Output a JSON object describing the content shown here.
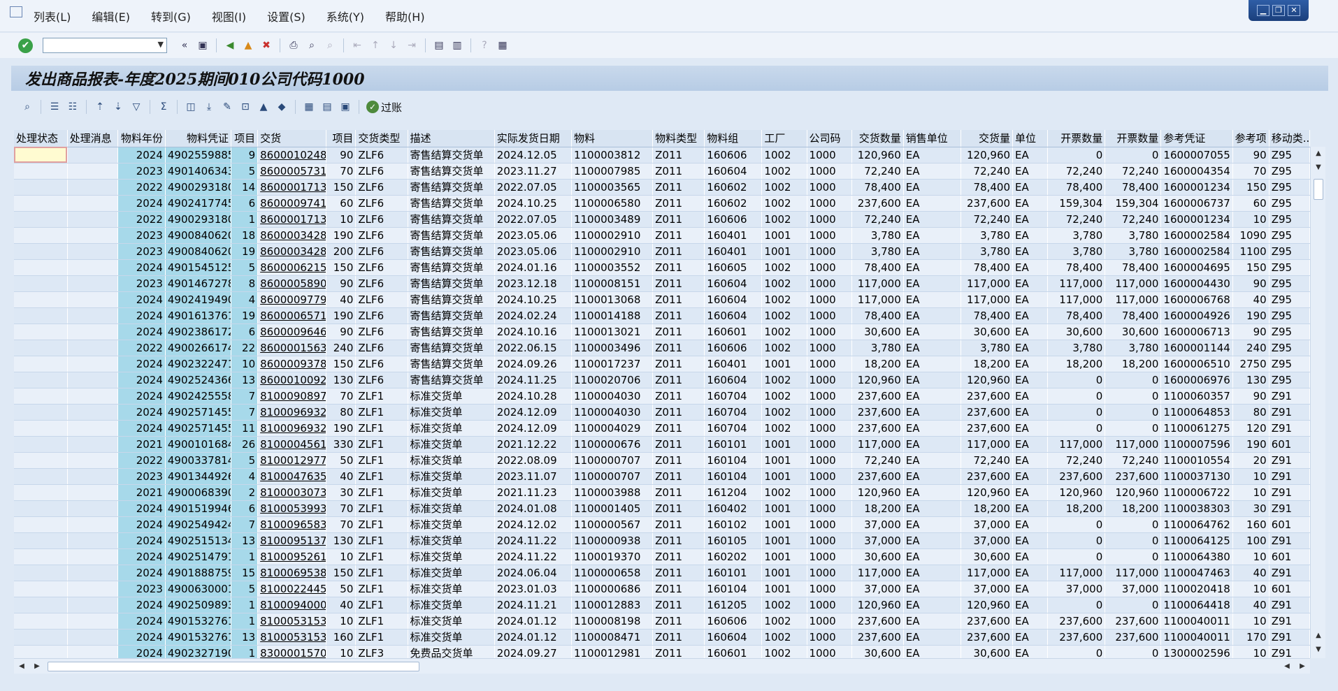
{
  "menubar": {
    "items": [
      "列表(L)",
      "编辑(E)",
      "转到(G)",
      "视图(I)",
      "设置(S)",
      "系统(Y)",
      "帮助(H)"
    ]
  },
  "toolbar": {
    "command_value": "",
    "back_glyph": "«"
  },
  "header": {
    "title": "发出商品报表-年度2025期间010公司代码1000"
  },
  "alv_toolbar": {
    "post_label": "过账"
  },
  "table": {
    "columns": [
      "处理状态",
      "处理消息",
      "物料年份",
      "物料凭证",
      "项目",
      "交货",
      "项目",
      "交货类型",
      "描述",
      "实际发货日期",
      "物料",
      "物料类型",
      "物料组",
      "工厂",
      "公司码",
      "交货数量",
      "销售单位",
      "交货量",
      "单位",
      "开票数量",
      "开票数量",
      "参考凭证",
      "参考项",
      "移动类..."
    ],
    "rows": [
      [
        "",
        "",
        "2024",
        "4902559885",
        "9",
        "8600010248",
        "90",
        "ZLF6",
        "寄售结算交货单",
        "2024.12.05",
        "1100003812",
        "Z011",
        "160606",
        "1002",
        "1000",
        "120,960",
        "EA",
        "120,960",
        "EA",
        "0",
        "0",
        "1600007055",
        "90",
        "Z95"
      ],
      [
        "",
        "",
        "2023",
        "4901406343",
        "5",
        "8600005731",
        "70",
        "ZLF6",
        "寄售结算交货单",
        "2023.11.27",
        "1100007985",
        "Z011",
        "160604",
        "1002",
        "1000",
        "72,240",
        "EA",
        "72,240",
        "EA",
        "72,240",
        "72,240",
        "1600004354",
        "70",
        "Z95"
      ],
      [
        "",
        "",
        "2022",
        "4900293180",
        "14",
        "8600001713",
        "150",
        "ZLF6",
        "寄售结算交货单",
        "2022.07.05",
        "1100003565",
        "Z011",
        "160602",
        "1002",
        "1000",
        "78,400",
        "EA",
        "78,400",
        "EA",
        "78,400",
        "78,400",
        "1600001234",
        "150",
        "Z95"
      ],
      [
        "",
        "",
        "2024",
        "4902417745",
        "6",
        "8600009741",
        "60",
        "ZLF6",
        "寄售结算交货单",
        "2024.10.25",
        "1100006580",
        "Z011",
        "160602",
        "1002",
        "1000",
        "237,600",
        "EA",
        "237,600",
        "EA",
        "159,304",
        "159,304",
        "1600006737",
        "60",
        "Z95"
      ],
      [
        "",
        "",
        "2022",
        "4900293180",
        "1",
        "8600001713",
        "10",
        "ZLF6",
        "寄售结算交货单",
        "2022.07.05",
        "1100003489",
        "Z011",
        "160606",
        "1002",
        "1000",
        "72,240",
        "EA",
        "72,240",
        "EA",
        "72,240",
        "72,240",
        "1600001234",
        "10",
        "Z95"
      ],
      [
        "",
        "",
        "2023",
        "4900840620",
        "18",
        "8600003428",
        "190",
        "ZLF6",
        "寄售结算交货单",
        "2023.05.06",
        "1100002910",
        "Z011",
        "160401",
        "1001",
        "1000",
        "3,780",
        "EA",
        "3,780",
        "EA",
        "3,780",
        "3,780",
        "1600002584",
        "1090",
        "Z95"
      ],
      [
        "",
        "",
        "2023",
        "4900840620",
        "19",
        "8600003428",
        "200",
        "ZLF6",
        "寄售结算交货单",
        "2023.05.06",
        "1100002910",
        "Z011",
        "160401",
        "1001",
        "1000",
        "3,780",
        "EA",
        "3,780",
        "EA",
        "3,780",
        "3,780",
        "1600002584",
        "1100",
        "Z95"
      ],
      [
        "",
        "",
        "2024",
        "4901545125",
        "5",
        "8600006215",
        "150",
        "ZLF6",
        "寄售结算交货单",
        "2024.01.16",
        "1100003552",
        "Z011",
        "160605",
        "1002",
        "1000",
        "78,400",
        "EA",
        "78,400",
        "EA",
        "78,400",
        "78,400",
        "1600004695",
        "150",
        "Z95"
      ],
      [
        "",
        "",
        "2023",
        "4901467278",
        "8",
        "8600005890",
        "90",
        "ZLF6",
        "寄售结算交货单",
        "2023.12.18",
        "1100008151",
        "Z011",
        "160604",
        "1002",
        "1000",
        "117,000",
        "EA",
        "117,000",
        "EA",
        "117,000",
        "117,000",
        "1600004430",
        "90",
        "Z95"
      ],
      [
        "",
        "",
        "2024",
        "4902419490",
        "4",
        "8600009779",
        "40",
        "ZLF6",
        "寄售结算交货单",
        "2024.10.25",
        "1100013068",
        "Z011",
        "160604",
        "1002",
        "1000",
        "117,000",
        "EA",
        "117,000",
        "EA",
        "117,000",
        "117,000",
        "1600006768",
        "40",
        "Z95"
      ],
      [
        "",
        "",
        "2024",
        "4901613761",
        "19",
        "8600006571",
        "190",
        "ZLF6",
        "寄售结算交货单",
        "2024.02.24",
        "1100014188",
        "Z011",
        "160604",
        "1002",
        "1000",
        "78,400",
        "EA",
        "78,400",
        "EA",
        "78,400",
        "78,400",
        "1600004926",
        "190",
        "Z95"
      ],
      [
        "",
        "",
        "2024",
        "4902386172",
        "6",
        "8600009646",
        "90",
        "ZLF6",
        "寄售结算交货单",
        "2024.10.16",
        "1100013021",
        "Z011",
        "160601",
        "1002",
        "1000",
        "30,600",
        "EA",
        "30,600",
        "EA",
        "30,600",
        "30,600",
        "1600006713",
        "90",
        "Z95"
      ],
      [
        "",
        "",
        "2022",
        "4900266174",
        "22",
        "8600001563",
        "240",
        "ZLF6",
        "寄售结算交货单",
        "2022.06.15",
        "1100003496",
        "Z011",
        "160606",
        "1002",
        "1000",
        "3,780",
        "EA",
        "3,780",
        "EA",
        "3,780",
        "3,780",
        "1600001144",
        "240",
        "Z95"
      ],
      [
        "",
        "",
        "2024",
        "4902322471",
        "10",
        "8600009378",
        "150",
        "ZLF6",
        "寄售结算交货单",
        "2024.09.26",
        "1100017237",
        "Z011",
        "160401",
        "1001",
        "1000",
        "18,200",
        "EA",
        "18,200",
        "EA",
        "18,200",
        "18,200",
        "1600006510",
        "2750",
        "Z95"
      ],
      [
        "",
        "",
        "2024",
        "4902524366",
        "13",
        "8600010092",
        "130",
        "ZLF6",
        "寄售结算交货单",
        "2024.11.25",
        "1100020706",
        "Z011",
        "160604",
        "1002",
        "1000",
        "120,960",
        "EA",
        "120,960",
        "EA",
        "0",
        "0",
        "1600006976",
        "130",
        "Z95"
      ],
      [
        "",
        "",
        "2024",
        "4902425558",
        "7",
        "8100090897",
        "70",
        "ZLF1",
        "标准交货单",
        "2024.10.28",
        "1100004030",
        "Z011",
        "160704",
        "1002",
        "1000",
        "237,600",
        "EA",
        "237,600",
        "EA",
        "0",
        "0",
        "1100060357",
        "90",
        "Z91"
      ],
      [
        "",
        "",
        "2024",
        "4902571455",
        "7",
        "8100096932",
        "80",
        "ZLF1",
        "标准交货单",
        "2024.12.09",
        "1100004030",
        "Z011",
        "160704",
        "1002",
        "1000",
        "237,600",
        "EA",
        "237,600",
        "EA",
        "0",
        "0",
        "1100064853",
        "80",
        "Z91"
      ],
      [
        "",
        "",
        "2024",
        "4902571455",
        "11",
        "8100096932",
        "190",
        "ZLF1",
        "标准交货单",
        "2024.12.09",
        "1100004029",
        "Z011",
        "160704",
        "1002",
        "1000",
        "237,600",
        "EA",
        "237,600",
        "EA",
        "0",
        "0",
        "1100061275",
        "120",
        "Z91"
      ],
      [
        "",
        "",
        "2021",
        "4900101684",
        "26",
        "8100004561",
        "330",
        "ZLF1",
        "标准交货单",
        "2021.12.22",
        "1100000676",
        "Z011",
        "160101",
        "1001",
        "1000",
        "117,000",
        "EA",
        "117,000",
        "EA",
        "117,000",
        "117,000",
        "1100007596",
        "190",
        "601"
      ],
      [
        "",
        "",
        "2022",
        "4900337814",
        "5",
        "8100012977",
        "50",
        "ZLF1",
        "标准交货单",
        "2022.08.09",
        "1100000707",
        "Z011",
        "160104",
        "1001",
        "1000",
        "72,240",
        "EA",
        "72,240",
        "EA",
        "72,240",
        "72,240",
        "1100010554",
        "20",
        "Z91"
      ],
      [
        "",
        "",
        "2023",
        "4901344926",
        "4",
        "8100047635",
        "40",
        "ZLF1",
        "标准交货单",
        "2023.11.07",
        "1100000707",
        "Z011",
        "160104",
        "1001",
        "1000",
        "237,600",
        "EA",
        "237,600",
        "EA",
        "237,600",
        "237,600",
        "1100037130",
        "10",
        "Z91"
      ],
      [
        "",
        "",
        "2021",
        "4900068390",
        "2",
        "8100003073",
        "30",
        "ZLF1",
        "标准交货单",
        "2021.11.23",
        "1100003988",
        "Z011",
        "161204",
        "1002",
        "1000",
        "120,960",
        "EA",
        "120,960",
        "EA",
        "120,960",
        "120,960",
        "1100006722",
        "10",
        "Z91"
      ],
      [
        "",
        "",
        "2024",
        "4901519946",
        "6",
        "8100053993",
        "70",
        "ZLF1",
        "标准交货单",
        "2024.01.08",
        "1100001405",
        "Z011",
        "160402",
        "1001",
        "1000",
        "18,200",
        "EA",
        "18,200",
        "EA",
        "18,200",
        "18,200",
        "1100038303",
        "30",
        "Z91"
      ],
      [
        "",
        "",
        "2024",
        "4902549424",
        "7",
        "8100096583",
        "70",
        "ZLF1",
        "标准交货单",
        "2024.12.02",
        "1100000567",
        "Z011",
        "160102",
        "1001",
        "1000",
        "37,000",
        "EA",
        "37,000",
        "EA",
        "0",
        "0",
        "1100064762",
        "160",
        "601"
      ],
      [
        "",
        "",
        "2024",
        "4902515134",
        "13",
        "8100095137",
        "130",
        "ZLF1",
        "标准交货单",
        "2024.11.22",
        "1100000938",
        "Z011",
        "160105",
        "1001",
        "1000",
        "37,000",
        "EA",
        "37,000",
        "EA",
        "0",
        "0",
        "1100064125",
        "100",
        "Z91"
      ],
      [
        "",
        "",
        "2024",
        "4902514791",
        "1",
        "8100095261",
        "10",
        "ZLF1",
        "标准交货单",
        "2024.11.22",
        "1100019370",
        "Z011",
        "160202",
        "1001",
        "1000",
        "30,600",
        "EA",
        "30,600",
        "EA",
        "0",
        "0",
        "1100064380",
        "10",
        "601"
      ],
      [
        "",
        "",
        "2024",
        "4901888759",
        "15",
        "8100069538",
        "150",
        "ZLF1",
        "标准交货单",
        "2024.06.04",
        "1100000658",
        "Z011",
        "160101",
        "1001",
        "1000",
        "117,000",
        "EA",
        "117,000",
        "EA",
        "117,000",
        "117,000",
        "1100047463",
        "40",
        "Z91"
      ],
      [
        "",
        "",
        "2023",
        "4900630001",
        "5",
        "8100022445",
        "50",
        "ZLF1",
        "标准交货单",
        "2023.01.03",
        "1100000686",
        "Z011",
        "160104",
        "1001",
        "1000",
        "37,000",
        "EA",
        "37,000",
        "EA",
        "37,000",
        "37,000",
        "1100020418",
        "10",
        "601"
      ],
      [
        "",
        "",
        "2024",
        "4902509893",
        "1",
        "8100094000",
        "40",
        "ZLF1",
        "标准交货单",
        "2024.11.21",
        "1100012883",
        "Z011",
        "161205",
        "1002",
        "1000",
        "120,960",
        "EA",
        "120,960",
        "EA",
        "0",
        "0",
        "1100064418",
        "40",
        "Z91"
      ],
      [
        "",
        "",
        "2024",
        "4901532761",
        "1",
        "8100053153",
        "10",
        "ZLF1",
        "标准交货单",
        "2024.01.12",
        "1100008198",
        "Z011",
        "160606",
        "1002",
        "1000",
        "237,600",
        "EA",
        "237,600",
        "EA",
        "237,600",
        "237,600",
        "1100040011",
        "10",
        "Z91"
      ],
      [
        "",
        "",
        "2024",
        "4901532761",
        "13",
        "8100053153",
        "160",
        "ZLF1",
        "标准交货单",
        "2024.01.12",
        "1100008471",
        "Z011",
        "160604",
        "1002",
        "1000",
        "237,600",
        "EA",
        "237,600",
        "EA",
        "237,600",
        "237,600",
        "1100040011",
        "170",
        "Z91"
      ],
      [
        "",
        "",
        "2024",
        "4902327190",
        "1",
        "8300001570",
        "10",
        "ZLF3",
        "免费品交货单",
        "2024.09.27",
        "1100012981",
        "Z011",
        "160601",
        "1002",
        "1000",
        "30,600",
        "EA",
        "30,600",
        "EA",
        "0",
        "0",
        "1300002596",
        "10",
        "Z91"
      ]
    ]
  }
}
